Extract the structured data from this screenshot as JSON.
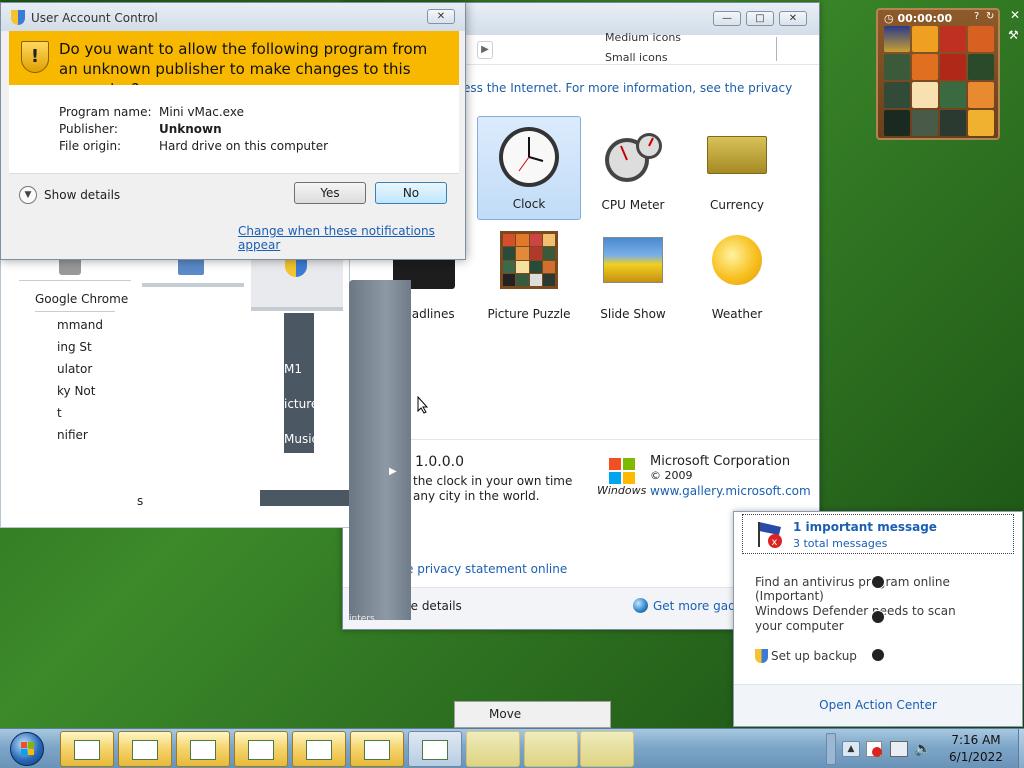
{
  "gallery": {
    "toolbar_menu": [
      "Medium icons",
      "Small icons"
    ],
    "internet_text": "ess the Internet.  For more information, see the privacy",
    "gadgets": [
      {
        "label": "Clock"
      },
      {
        "label": "CPU Meter"
      },
      {
        "label": "Currency"
      },
      {
        "label": "Headlines"
      },
      {
        "label": "Picture Puzzle"
      },
      {
        "label": "Slide Show"
      },
      {
        "label": "Weather"
      }
    ],
    "version": "1.0.0.0",
    "desc_line1": "the clock in your own time",
    "desc_line2": "any city in the world.",
    "publisher": "Microsoft Corporation",
    "year": "© 2009",
    "windows_word": "Windows",
    "site": "www.gallery.microsoft.com",
    "privacy_link": "e privacy statement online",
    "hide_details": "de details",
    "get_more": "Get more gadg"
  },
  "leftwin": {
    "tab_label": "Google Chrome",
    "items": [
      "mmand",
      "ing St",
      "ulator",
      "ky Not",
      "t",
      "nifier",
      "s"
    ],
    "dark_items": [
      "M1",
      "icture",
      "Music"
    ]
  },
  "startpanel": {
    "bottom_text": "inters"
  },
  "uac": {
    "title": "User Account Control",
    "question": "Do you want to allow the following program from an unknown publisher to make changes to this computer?",
    "program_label": "Program name:",
    "program_value": "Mini vMac.exe",
    "publisher_label": "Publisher:",
    "publisher_value": "Unknown",
    "origin_label": "File origin:",
    "origin_value": "Hard drive on this computer",
    "show_details": "Show details",
    "yes": "Yes",
    "no": "No",
    "change_link": "Change when these notifications appear"
  },
  "puzzle": {
    "timer": "00:00:00"
  },
  "action_center": {
    "important": "1 important message",
    "total": "3 total messages",
    "items": [
      "Find an antivirus program online (Important)",
      "Windows Defender needs to scan your computer",
      "Set up backup"
    ],
    "open": "Open Action Center"
  },
  "context_menu": {
    "move": "Move"
  },
  "taskbar": {
    "time": "7:16 AM",
    "date": "6/1/2022"
  },
  "colors": {
    "uac_banner": "#f9b800",
    "link": "#1a5fb4",
    "taskbar": "#7ea6c8"
  }
}
